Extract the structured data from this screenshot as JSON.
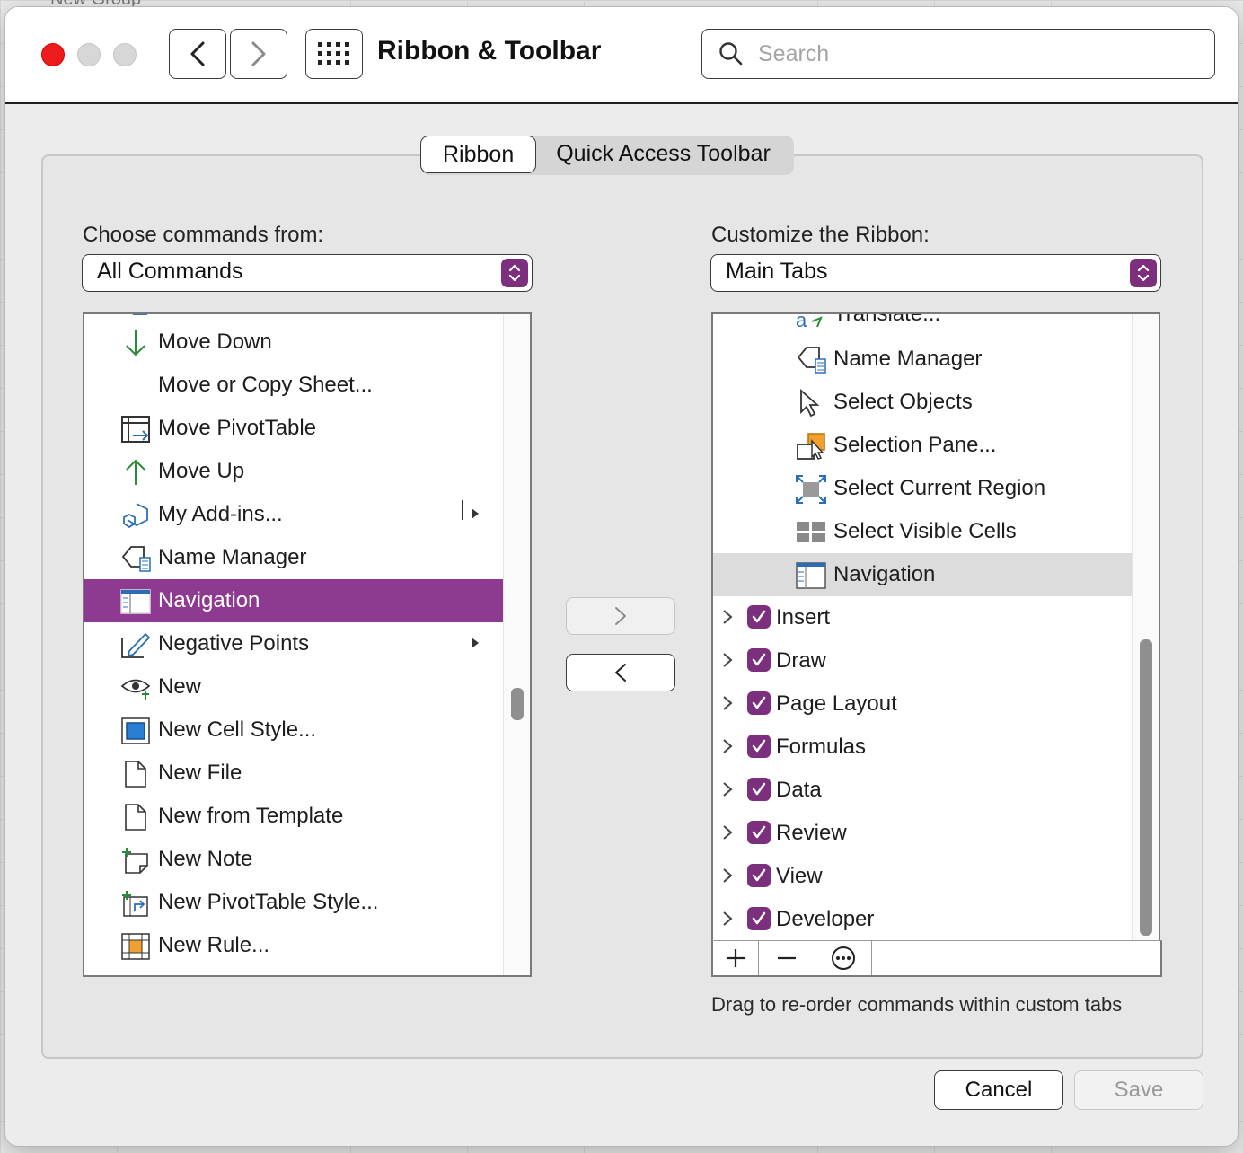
{
  "background": {
    "behind_text": "New Group"
  },
  "window": {
    "title": "Ribbon & Toolbar",
    "search_placeholder": "Search",
    "traffic_lights": {
      "close": "#ec1c1c",
      "minimize": "#d7d7d7",
      "zoom": "#d7d7d7"
    }
  },
  "tabs": {
    "ribbon": "Ribbon",
    "qat": "Quick Access Toolbar",
    "active": "Ribbon"
  },
  "left": {
    "label": "Choose commands from:",
    "dropdown_value": "All Commands",
    "items": [
      {
        "label": "Move Down",
        "icon": "arrow-down-icon"
      },
      {
        "label": "Move or Copy Sheet...",
        "icon": ""
      },
      {
        "label": "Move PivotTable",
        "icon": "move-pivottable-icon"
      },
      {
        "label": "Move Up",
        "icon": "arrow-up-icon"
      },
      {
        "label": "My Add-ins...",
        "icon": "add-ins-icon",
        "submenu": true
      },
      {
        "label": "Name Manager",
        "icon": "name-manager-icon"
      },
      {
        "label": "Navigation",
        "icon": "navigation-pane-icon",
        "selected": true
      },
      {
        "label": "Negative Points",
        "icon": "negative-points-icon",
        "submenu": true
      },
      {
        "label": "New",
        "icon": "new-window-eye-icon"
      },
      {
        "label": "New Cell Style...",
        "icon": "cell-style-icon"
      },
      {
        "label": "New File",
        "icon": "document-icon"
      },
      {
        "label": "New from Template",
        "icon": "document-icon"
      },
      {
        "label": "New Note",
        "icon": "new-note-icon"
      },
      {
        "label": "New PivotTable Style...",
        "icon": "pivottable-style-icon"
      },
      {
        "label": "New Rule...",
        "icon": "new-rule-icon"
      }
    ]
  },
  "right": {
    "label": "Customize the Ribbon:",
    "dropdown_value": "Main Tabs",
    "partial_top": "Translate...",
    "commands": [
      {
        "label": "Name Manager",
        "icon": "name-manager-icon"
      },
      {
        "label": "Select Objects",
        "icon": "pointer-icon"
      },
      {
        "label": "Selection Pane...",
        "icon": "selection-pane-icon"
      },
      {
        "label": "Select Current Region",
        "icon": "select-region-icon"
      },
      {
        "label": "Select Visible Cells",
        "icon": "visible-cells-icon"
      },
      {
        "label": "Navigation",
        "icon": "navigation-pane-icon",
        "highlighted": true
      }
    ],
    "tabs": [
      {
        "label": "Insert",
        "checked": true
      },
      {
        "label": "Draw",
        "checked": true
      },
      {
        "label": "Page Layout",
        "checked": true
      },
      {
        "label": "Formulas",
        "checked": true
      },
      {
        "label": "Data",
        "checked": true
      },
      {
        "label": "Review",
        "checked": true
      },
      {
        "label": "View",
        "checked": true
      },
      {
        "label": "Developer",
        "checked": true
      }
    ],
    "toolbar": {
      "add": "+",
      "remove": "−",
      "more": "more-options-icon"
    },
    "hint": "Drag to re-order commands within custom tabs"
  },
  "buttons": {
    "cancel": "Cancel",
    "save": "Save"
  },
  "colors": {
    "accent": "#7b2f7c",
    "selection": "#8d3a90"
  }
}
